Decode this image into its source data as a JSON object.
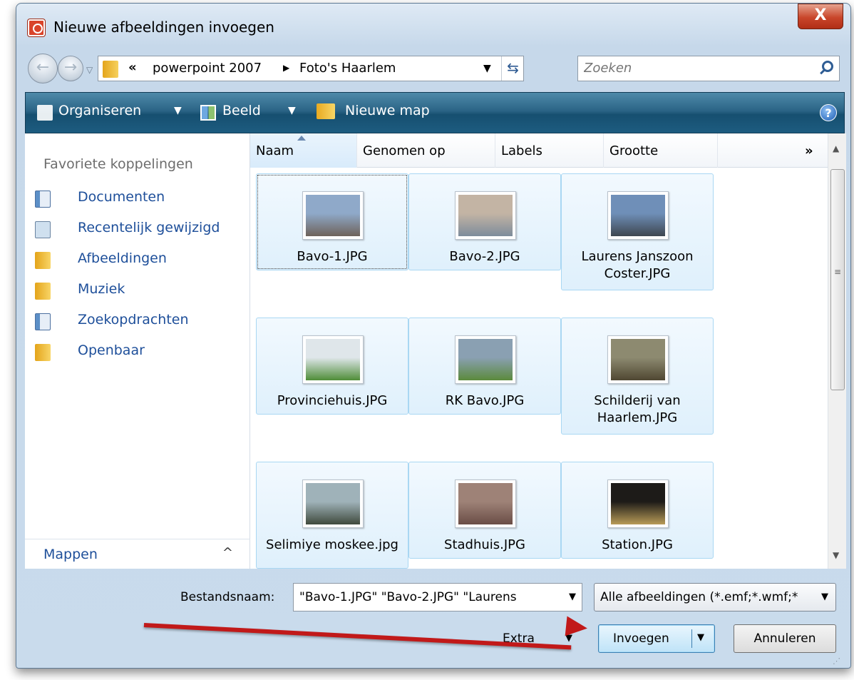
{
  "window": {
    "title": "Nieuwe afbeeldingen invoegen",
    "close_label": "X"
  },
  "address": {
    "prefix": "«",
    "crumbs": [
      "powerpoint 2007",
      "Foto's Haarlem"
    ],
    "separator": "▶"
  },
  "search": {
    "placeholder": "Zoeken"
  },
  "toolbar": {
    "organize": "Organiseren",
    "view": "Beeld",
    "new_folder": "Nieuwe map",
    "help": "?"
  },
  "sidebar": {
    "heading": "Favoriete koppelingen",
    "items": [
      {
        "label": "Documenten",
        "icon": "documents-icon"
      },
      {
        "label": "Recentelijk gewijzigd",
        "icon": "recent-icon"
      },
      {
        "label": "Afbeeldingen",
        "icon": "folder-icon"
      },
      {
        "label": "Muziek",
        "icon": "folder-icon"
      },
      {
        "label": "Zoekopdrachten",
        "icon": "search-folder-icon"
      },
      {
        "label": "Openbaar",
        "icon": "folder-icon"
      }
    ],
    "folders_label": "Mappen",
    "folders_caret": "^"
  },
  "columns": {
    "name": "Naam",
    "taken": "Genomen op",
    "labels": "Labels",
    "size": "Grootte",
    "more": "»"
  },
  "files": [
    {
      "name": "Bavo-1.JPG",
      "thumb": [
        "#8fa9c9",
        "#6e625a"
      ]
    },
    {
      "name": "Bavo-2.JPG",
      "thumb": [
        "#c3b4a4",
        "#7d8c9b"
      ]
    },
    {
      "name": "Laurens Janszoon Coster.JPG",
      "thumb": [
        "#6f8fb8",
        "#3e4650"
      ]
    },
    {
      "name": "Provinciehuis.JPG",
      "thumb": [
        "#dfe6ea",
        "#4f8d38"
      ]
    },
    {
      "name": "RK Bavo.JPG",
      "thumb": [
        "#8aa0b2",
        "#5b8a3c"
      ]
    },
    {
      "name": "Schilderij van Haarlem.JPG",
      "thumb": [
        "#8d8a70",
        "#4f4732"
      ]
    },
    {
      "name": "Selimiye moskee.jpg",
      "thumb": [
        "#9fb2b9",
        "#3f4a3d"
      ]
    },
    {
      "name": "Stadhuis.JPG",
      "thumb": [
        "#9e8277",
        "#6a4d46"
      ]
    },
    {
      "name": "Station.JPG",
      "thumb": [
        "#1d1b18",
        "#b89b58"
      ]
    }
  ],
  "bottom": {
    "filename_label": "Bestandsnaam:",
    "filename_value": "\"Bavo-1.JPG\" \"Bavo-2.JPG\" \"Laurens",
    "filetype_value": "Alle afbeeldingen (*.emf;*.wmf;*",
    "extra_label": "Extra",
    "insert_label": "Invoegen",
    "cancel_label": "Annuleren"
  },
  "colors": {
    "accent_arrow": "#c11919",
    "link": "#1e4f9a",
    "toolbar": "#1d5c80"
  }
}
